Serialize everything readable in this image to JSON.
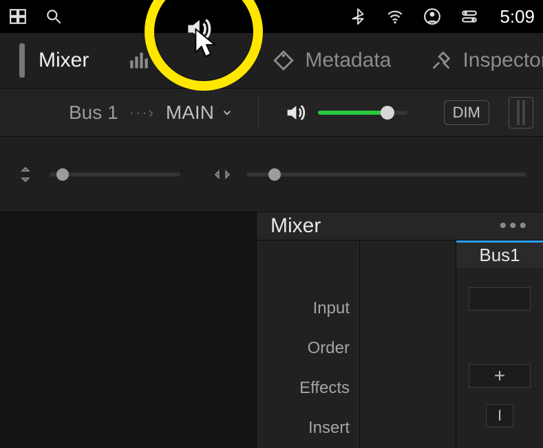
{
  "status": {
    "time": "5:09"
  },
  "tabs": {
    "mixer": "Mixer",
    "metadata": "Metadata",
    "inspector": "Inspector"
  },
  "bus": {
    "name": "Bus 1",
    "route_arrow": "···›",
    "dest": "MAIN",
    "dim": "DIM"
  },
  "mixer_panel": {
    "title": "Mixer",
    "channel": "Bus1",
    "rows": {
      "input": "Input",
      "order": "Order",
      "effects": "Effects",
      "insert": "Insert"
    },
    "effects_add": "+",
    "insert_badge": "I"
  }
}
